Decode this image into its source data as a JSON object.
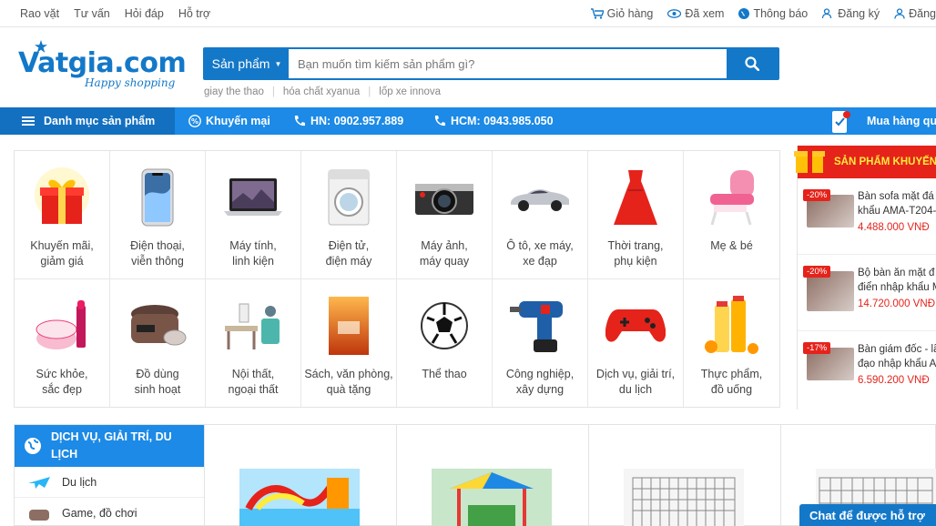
{
  "topbar": {
    "left_links": [
      "Rao vặt",
      "Tư vấn",
      "Hỏi đáp",
      "Hỗ trợ"
    ],
    "cart": "Giỏ hàng",
    "viewed": "Đã xem",
    "notify": "Thông báo",
    "register": "Đăng ký",
    "login": "Đăng"
  },
  "logo": {
    "brand": "Vatgia.com",
    "tagline": "Happy shopping"
  },
  "search": {
    "category": "Sản phẩm",
    "placeholder": "Bạn muốn tìm kiếm sản phẩm gì?",
    "suggestions": [
      "giay the thao",
      "hóa chất xyanua",
      "lốp xe innova"
    ]
  },
  "nav": {
    "menu": "Danh mục sản phẩm",
    "promo": "Khuyến mại",
    "hn": "HN: 0902.957.889",
    "hcm": "HCM: 0943.985.050",
    "buy": "Mua hàng qua"
  },
  "categories": [
    {
      "l1": "Khuyến mãi,",
      "l2": "giảm giá",
      "icon": "gift-icon"
    },
    {
      "l1": "Điện thoại,",
      "l2": "viễn thông",
      "icon": "phone-icon"
    },
    {
      "l1": "Máy tính,",
      "l2": "linh kiện",
      "icon": "laptop-icon"
    },
    {
      "l1": "Điện tử,",
      "l2": "điện máy",
      "icon": "washer-icon"
    },
    {
      "l1": "Máy ảnh,",
      "l2": "máy quay",
      "icon": "camera-icon"
    },
    {
      "l1": "Ô tô, xe máy,",
      "l2": "xe đạp",
      "icon": "car-icon"
    },
    {
      "l1": "Thời trang,",
      "l2": "phụ kiện",
      "icon": "dress-icon"
    },
    {
      "l1": "Mẹ & bé",
      "l2": "",
      "icon": "baby-chair-icon"
    },
    {
      "l1": "Sức khỏe,",
      "l2": "sắc đẹp",
      "icon": "cosmetics-icon"
    },
    {
      "l1": "Đồ dùng",
      "l2": "sinh hoạt",
      "icon": "rice-cooker-icon"
    },
    {
      "l1": "Nội thất,",
      "l2": "ngoại thất",
      "icon": "furniture-icon"
    },
    {
      "l1": "Sách, văn phòng,",
      "l2": "quà tặng",
      "icon": "book-icon"
    },
    {
      "l1": "Thể thao",
      "l2": "",
      "icon": "football-icon"
    },
    {
      "l1": "Công nghiệp,",
      "l2": "xây dựng",
      "icon": "drill-icon"
    },
    {
      "l1": "Dịch vụ, giải trí,",
      "l2": "du lịch",
      "icon": "gamepad-icon"
    },
    {
      "l1": "Thực phẩm,",
      "l2": "đồ uống",
      "icon": "juice-icon"
    }
  ],
  "promo": {
    "title": "SẢN PHẨM KHUYẾN MÃI",
    "items": [
      {
        "discount": "-20%",
        "line1": "Bàn sofa mặt đá",
        "line2": "khẩu AMA-T204-",
        "price": "4.488.000 VNĐ"
      },
      {
        "discount": "-20%",
        "line1": "Bộ bàn ăn mặt đ",
        "line2": "điển nhập khẩu M",
        "price": "14.720.000 VNĐ"
      },
      {
        "discount": "-17%",
        "line1": "Bàn giám đốc - lã",
        "line2": "đạo nhập khẩu A",
        "price": "6.590.200 VNĐ"
      }
    ]
  },
  "services": {
    "title_l1": "DỊCH VỤ, GIẢI TRÍ, DU",
    "title_l2": "LỊCH",
    "items": [
      "Du lịch",
      "Game, đồ chơi"
    ]
  },
  "chat": "Chat để được hỗ trợ",
  "colors": {
    "primary": "#1478c8",
    "nav": "#1c8ae6",
    "promo": "#e5231b"
  }
}
